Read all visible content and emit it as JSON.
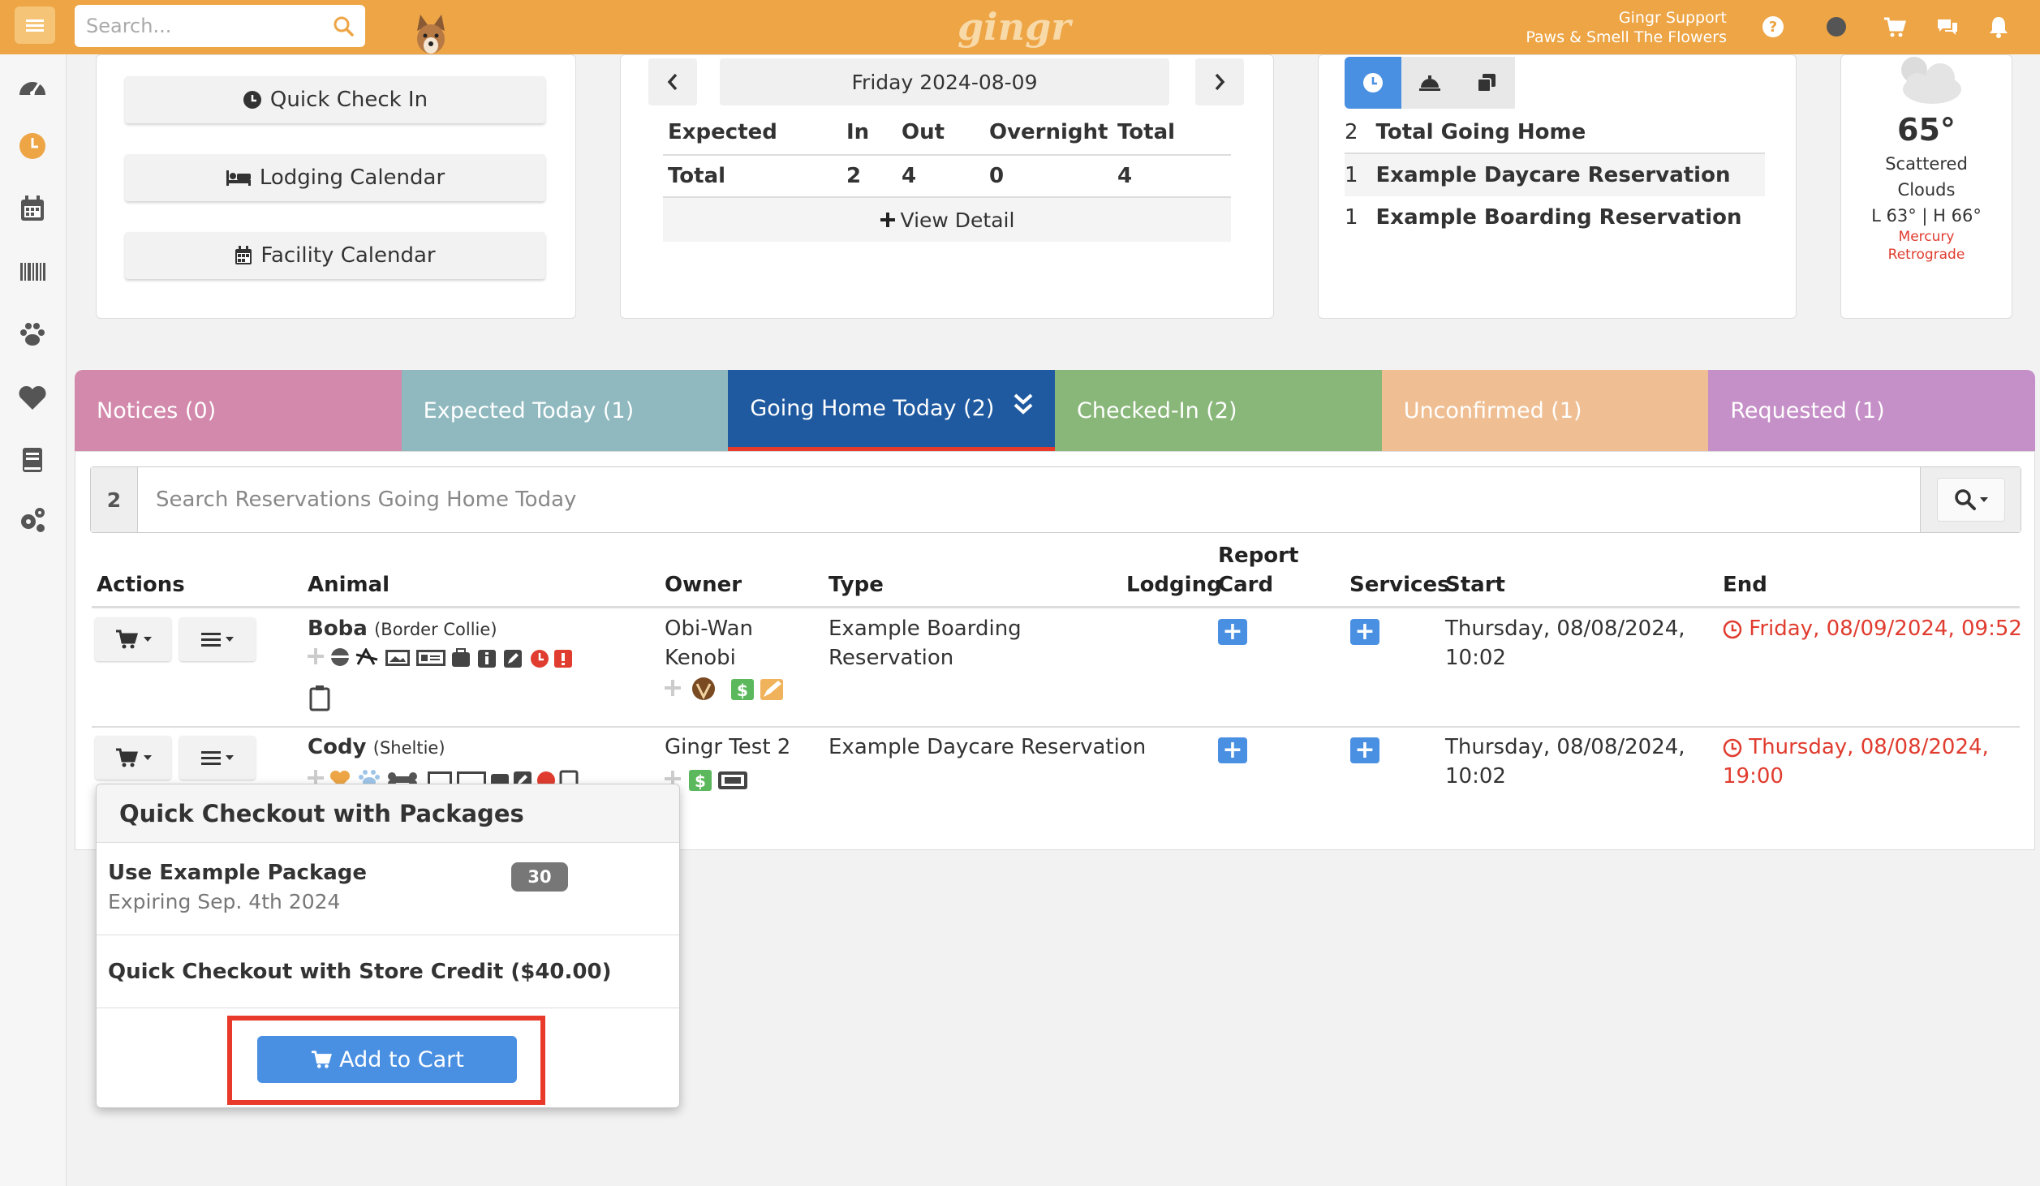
{
  "topbar": {
    "search_placeholder": "Search...",
    "logo": "gingr",
    "user_name": "Gingr Support",
    "business_name": "Paws & Smell The Flowers"
  },
  "quick_actions": {
    "check_in": "Quick Check In",
    "lodging_calendar": "Lodging Calendar",
    "facility_calendar": "Facility Calendar"
  },
  "summary": {
    "date": "Friday 2024-08-09",
    "headers": [
      "Expected",
      "In",
      "Out",
      "Overnight",
      "Total"
    ],
    "total_row": [
      "Total",
      "2",
      "4",
      "0",
      "4"
    ],
    "view_detail": "View Detail"
  },
  "going_home_panel": {
    "items": [
      {
        "count": "2",
        "label": "Total Going Home"
      },
      {
        "count": "1",
        "label": "Example Daycare Reservation"
      },
      {
        "count": "1",
        "label": "Example Boarding Reservation"
      }
    ]
  },
  "weather": {
    "temp": "65°",
    "condition_1": "Scattered",
    "condition_2": "Clouds",
    "range": "L 63° | H 66°",
    "note_1": "Mercury",
    "note_2": "Retrograde"
  },
  "tabs": [
    {
      "label": "Notices (0)",
      "color": "#d389ab"
    },
    {
      "label": "Expected Today (1)",
      "color": "#8fb9bf"
    },
    {
      "label": "Going Home Today (2)",
      "color": "#1f5aa0"
    },
    {
      "label": "Checked-In (2)",
      "color": "#89b77a"
    },
    {
      "label": "Unconfirmed (1)",
      "color": "#efbf93"
    },
    {
      "label": "Requested (1)",
      "color": "#c58fc7"
    }
  ],
  "reservation_search": {
    "count": "2",
    "placeholder": "Search Reservations Going Home Today"
  },
  "table": {
    "headers": {
      "actions": "Actions",
      "animal": "Animal",
      "owner": "Owner",
      "type": "Type",
      "lodging": "Lodging",
      "report_1": "Report",
      "report_2": "Card",
      "services": "Services",
      "start": "Start",
      "end": "End"
    },
    "rows": [
      {
        "animal_name": "Boba",
        "breed": "(Border Collie)",
        "owner_1": "Obi-Wan",
        "owner_2": "Kenobi",
        "type_1": "Example Boarding",
        "type_2": "Reservation",
        "start_1": "Thursday, 08/08/2024,",
        "start_2": "10:02",
        "end_1": "Friday, 08/09/2024, 09:52",
        "end_2": ""
      },
      {
        "animal_name": "Cody",
        "breed": "(Sheltie)",
        "owner_1": "Gingr Test 2",
        "owner_2": "",
        "type_1": "Example Daycare Reservation",
        "type_2": "",
        "start_1": "Thursday, 08/08/2024,",
        "start_2": "10:02",
        "end_1": "Thursday, 08/08/2024,",
        "end_2": "19:00"
      }
    ]
  },
  "popup": {
    "title": "Quick Checkout with Packages",
    "package_name": "Use Example Package",
    "package_expiry": "Expiring Sep. 4th 2024",
    "package_count": "30",
    "store_credit": "Quick Checkout with Store Credit ($40.00)",
    "add_to_cart": "Add to Cart"
  }
}
